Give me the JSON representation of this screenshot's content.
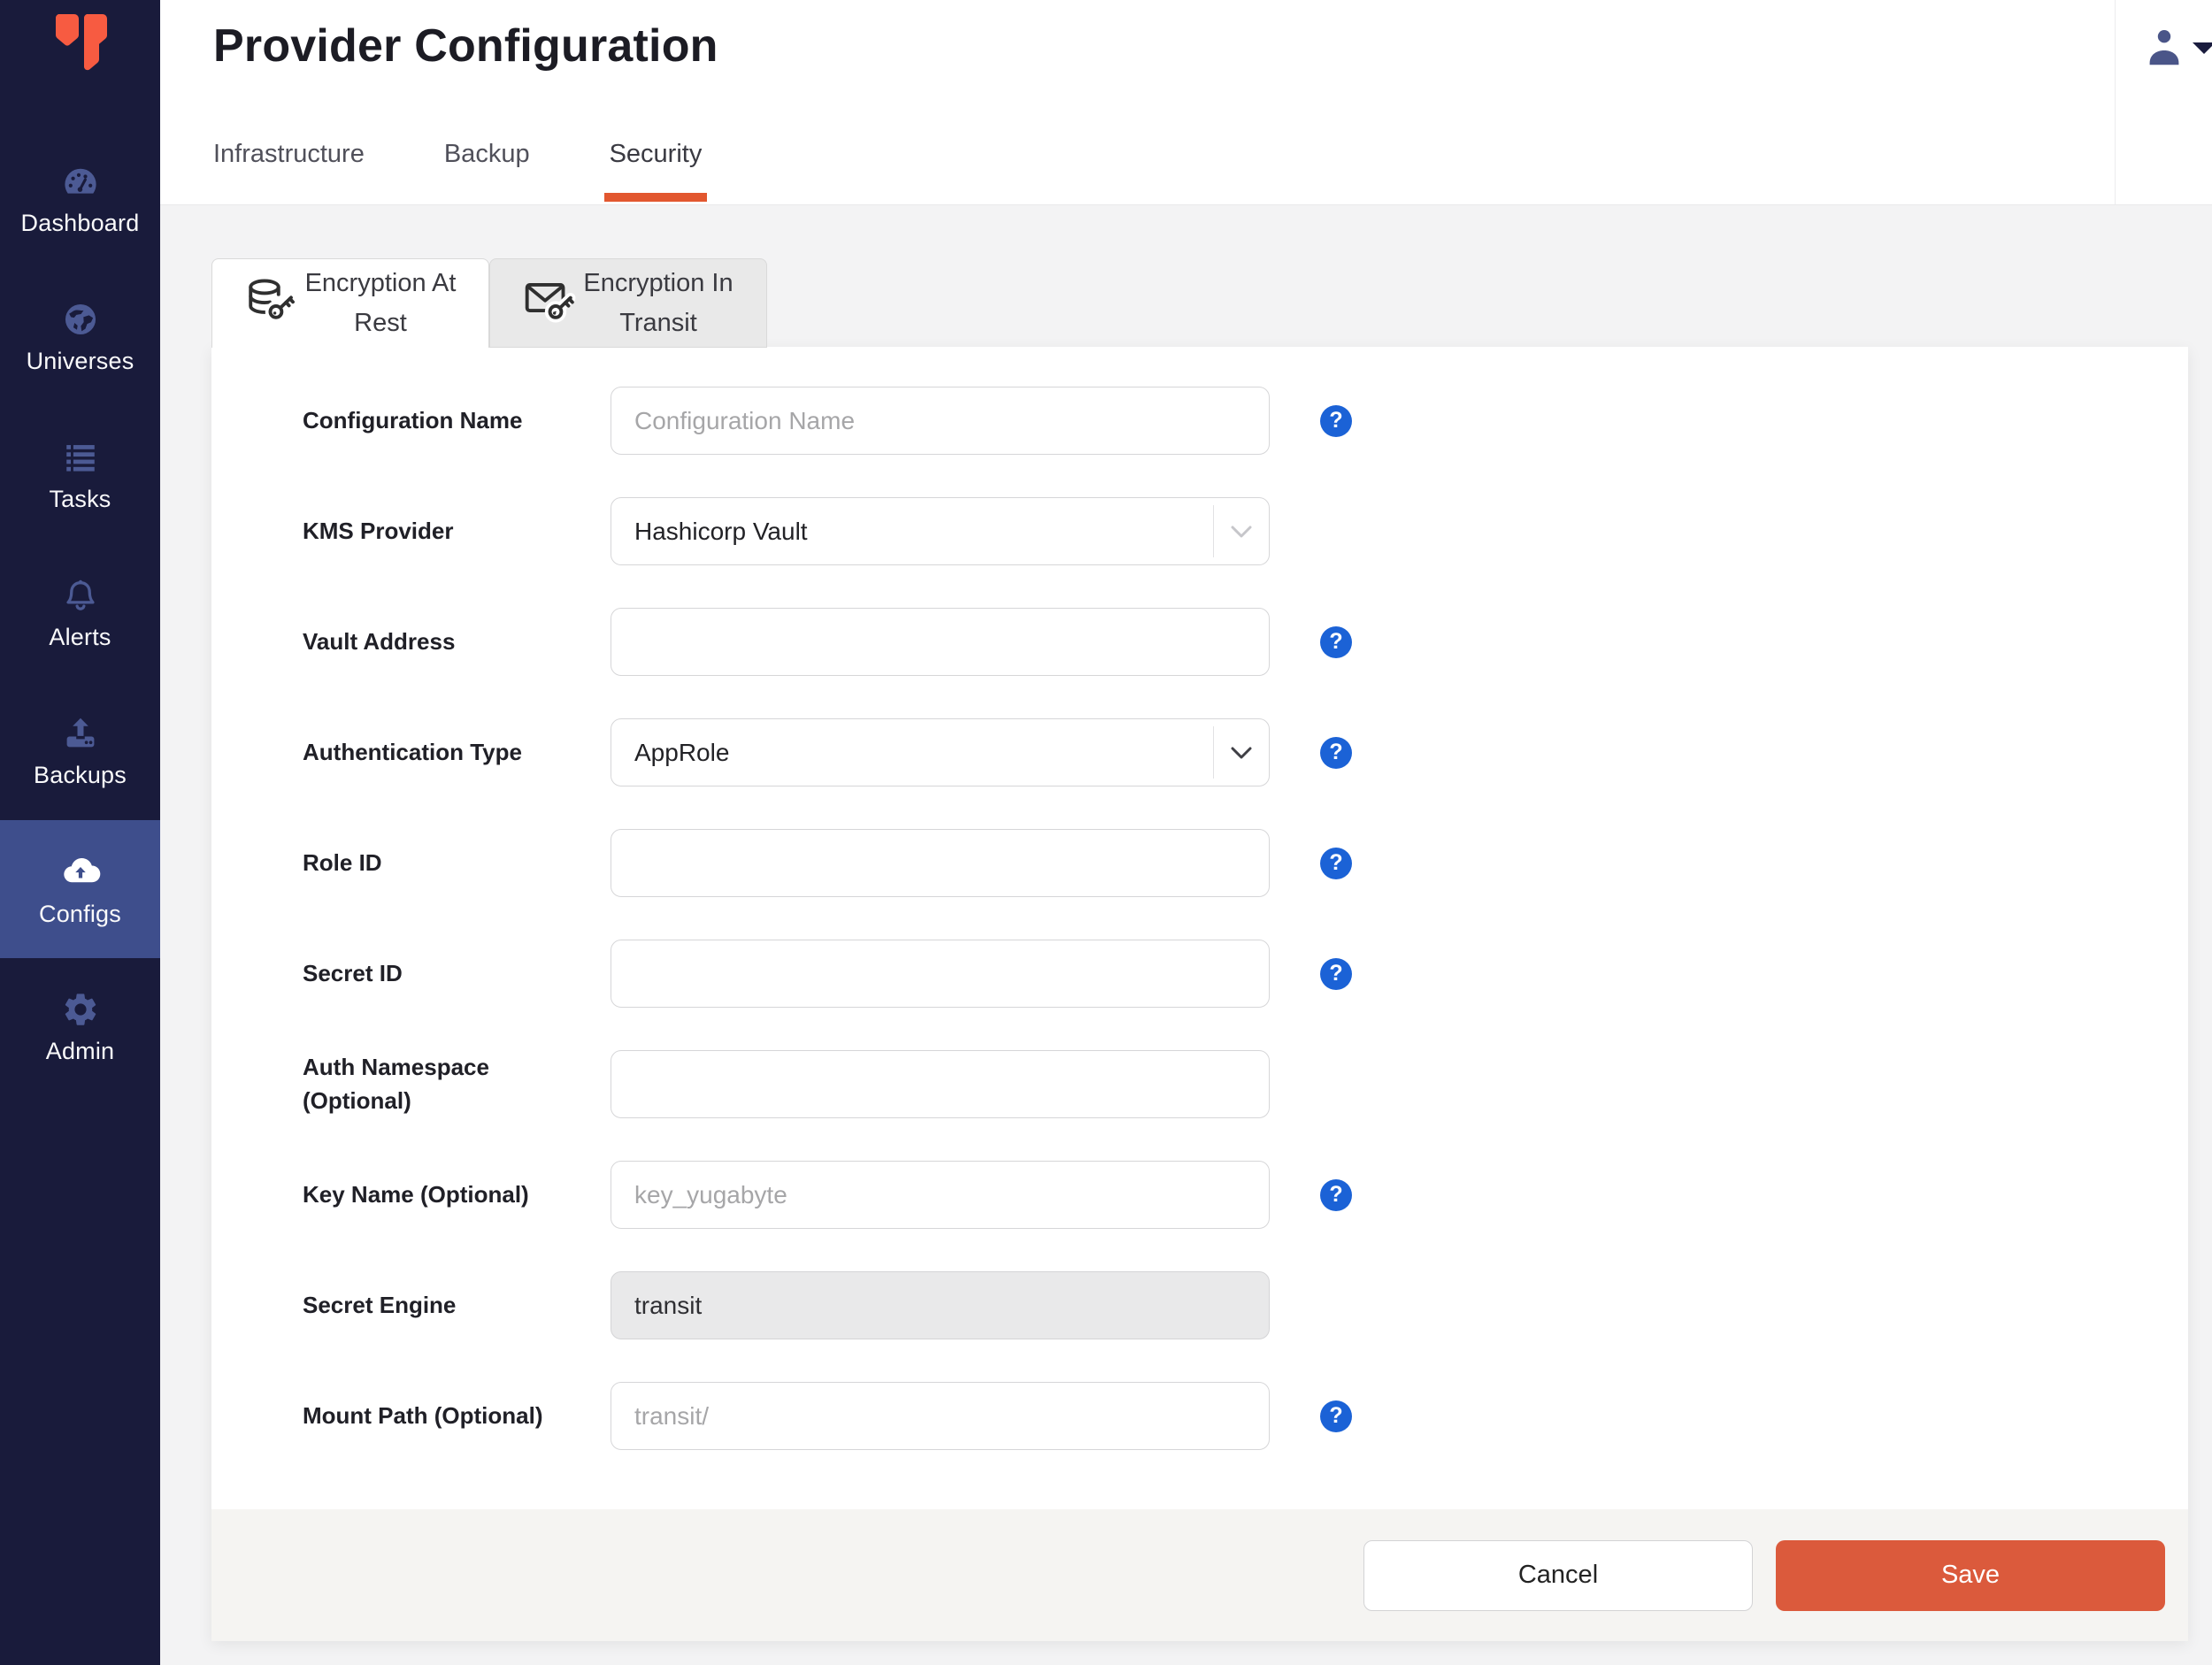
{
  "sidebar": {
    "items": [
      {
        "label": "Dashboard",
        "icon": "gauge-icon",
        "active": false
      },
      {
        "label": "Universes",
        "icon": "globe-icon",
        "active": false
      },
      {
        "label": "Tasks",
        "icon": "task-list-icon",
        "active": false
      },
      {
        "label": "Alerts",
        "icon": "bell-icon",
        "active": false
      },
      {
        "label": "Backups",
        "icon": "backup-upload-icon",
        "active": false
      },
      {
        "label": "Configs",
        "icon": "cloud-upload-icon",
        "active": true
      },
      {
        "label": "Admin",
        "icon": "gear-icon",
        "active": false
      }
    ]
  },
  "header": {
    "title": "Provider Configuration",
    "tabs": [
      {
        "label": "Infrastructure",
        "active": false
      },
      {
        "label": "Backup",
        "active": false
      },
      {
        "label": "Security",
        "active": true
      }
    ]
  },
  "security_tabs": [
    {
      "label": "Encryption At Rest",
      "icon": "database-key-icon",
      "active": true
    },
    {
      "label": "Encryption In Transit",
      "icon": "envelope-key-icon",
      "active": false
    }
  ],
  "form": {
    "fields": [
      {
        "label": "Configuration Name",
        "type": "text",
        "value": "",
        "placeholder": "Configuration Name",
        "help": true
      },
      {
        "label": "KMS Provider",
        "type": "select",
        "value": "Hashicorp Vault",
        "help": false
      },
      {
        "label": "Vault Address",
        "type": "text",
        "value": "",
        "placeholder": "",
        "help": true
      },
      {
        "label": "Authentication Type",
        "type": "select",
        "value": "AppRole",
        "help": true
      },
      {
        "label": "Role ID",
        "type": "text",
        "value": "",
        "placeholder": "",
        "help": true
      },
      {
        "label": "Secret ID",
        "type": "text",
        "value": "",
        "placeholder": "",
        "help": true
      },
      {
        "label": "Auth Namespace (Optional)",
        "type": "text",
        "value": "",
        "placeholder": "",
        "help": false
      },
      {
        "label": "Key Name (Optional)",
        "type": "text",
        "value": "",
        "placeholder": "key_yugabyte",
        "help": true
      },
      {
        "label": "Secret Engine",
        "type": "text_disabled",
        "value": "transit",
        "help": false
      },
      {
        "label": "Mount Path (Optional)",
        "type": "text",
        "value": "",
        "placeholder": "transit/",
        "help": true
      }
    ]
  },
  "footer": {
    "cancel_label": "Cancel",
    "save_label": "Save"
  },
  "icons": {
    "help_glyph": "?"
  },
  "colors": {
    "sidebar_bg": "#191B3B",
    "sidebar_active_bg": "#3E4E8C",
    "sidebar_icon": "#4C5A94",
    "logo_orange": "#F75B41",
    "tab_underline": "#E2572F",
    "save_orange": "#DB5A3C",
    "help_blue": "#1B62D6",
    "content_bg": "#F3F3F4",
    "footer_bg": "#F5F4F2"
  }
}
